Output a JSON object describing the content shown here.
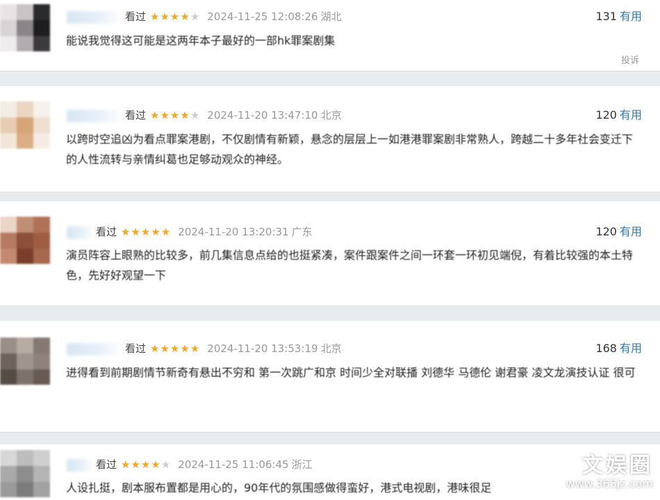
{
  "colors": {
    "page_bg": "#e9ecef",
    "star_on": "#f5a623",
    "useful_link": "#3377aa"
  },
  "reviews": [
    {
      "status": "看过",
      "rating": 4,
      "time": "2024-11-25 12:08:26",
      "location": "湖北",
      "votes": "131",
      "useful_label": "有用",
      "content": "能说我觉得这可能是这两年本子最好的一部hk罪案剧集",
      "report_label": "投诉"
    },
    {
      "status": "看过",
      "rating": 4,
      "time": "2024-11-20 13:47:10",
      "location": "北京",
      "votes": "120",
      "useful_label": "有用",
      "content": "以跨时空追凶为看点罪案港剧，不仅剧情有新颖，悬念的层层上一如港港罪案剧非常熟人，跨越二十多年社会变迁下的人性流转与亲情纠葛也足够动观众的神经。"
    },
    {
      "status": "看过",
      "rating": 5,
      "time": "2024-11-20 13:20:31",
      "location": "广东",
      "votes": "120",
      "useful_label": "有用",
      "content": "演员阵容上眼熟的比较多，前几集信息点给的也挺紧凑，案件跟案件之间一环套一环初见端倪，有着比较强的本土特色，先好好观望一下"
    },
    {
      "status": "看过",
      "rating": 5,
      "time": "2024-11-20 13:53:19",
      "location": "北京",
      "votes": "168",
      "useful_label": "有用",
      "content": "进得看到前期剧情节新奇有悬出不穷和 第一次跳广和京 时间少全对联播 刘德华 马德伦 谢君豪 凌文龙演技认证 很可"
    },
    {
      "status": "看过",
      "rating": 4,
      "time": "2024-11-25 11:06:45",
      "location": "浙江",
      "content": "人设扎挺，剧本服布置都是用心的，90年代的氛围感做得蛮好，港式电视剧，港味很足"
    }
  ],
  "watermark": {
    "name": "文娱圈",
    "url": "www.365jz.com"
  }
}
